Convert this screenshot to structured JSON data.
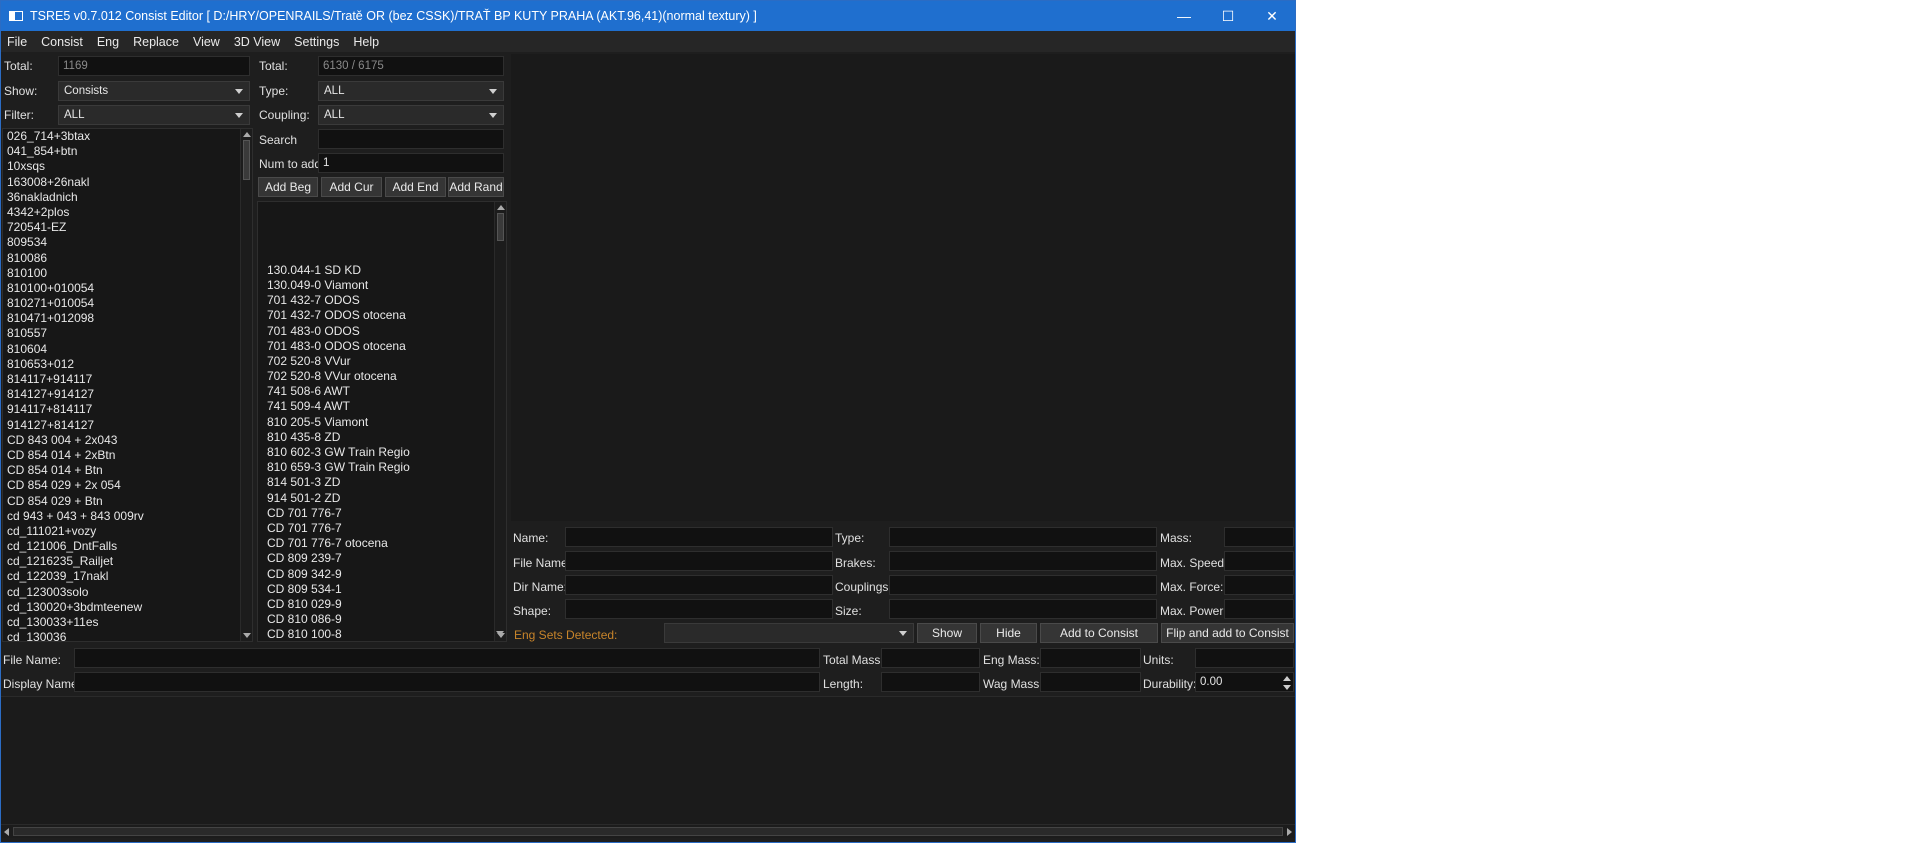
{
  "window": {
    "title": "TSRE5 v0.7.012 Consist Editor   [ D:/HRY/OPENRAILS/Tratě OR (bez CSSK)/TRAŤ BP KUTY PRAHA (AKT.96,41)(normal textury) ]",
    "minimize": "—",
    "maximize": "☐",
    "close": "✕"
  },
  "menu": [
    "File",
    "Consist",
    "Eng",
    "Replace",
    "View",
    "3D View",
    "Settings",
    "Help"
  ],
  "left_panel": {
    "total_label": "Total:",
    "total_value": "1169",
    "show_label": "Show:",
    "show_value": "Consists",
    "filter_label": "Filter:",
    "filter_value": "ALL",
    "items": [
      "026_714+3btax",
      "041_854+btn",
      "10xsqs",
      "163008+26nakl",
      "36nakladnich",
      "4342+2plos",
      "720541-EZ",
      "809534",
      "810086",
      "810100",
      "810100+010054",
      "810271+010054",
      "810471+012098",
      "810557",
      "810604",
      "810653+012",
      "814117+914117",
      "814127+914127",
      "914117+814117",
      "914127+814127",
      "CD 843 004 + 2x043",
      "CD 854 014 + 2xBtn",
      "CD 854 014 + Btn",
      "CD 854 029 + 2x 054",
      "CD 854 029 + Btn",
      "cd 943 + 043 + 843 009rv",
      "cd_111021+vozy",
      "cd_121006_DntFalls",
      "cd_1216235_Railjet",
      "cd_122039_17nakl",
      "cd_123003solo",
      "cd_130020+3bdmteenew",
      "cd_130033+11es",
      "cd_130036"
    ]
  },
  "middle_panel": {
    "total_label": "Total:",
    "total_value": "6130 / 6175",
    "type_label": "Type:",
    "type_value": "ALL",
    "coupling_label": "Coupling:",
    "coupling_value": "ALL",
    "search_label": "Search",
    "search_value": "",
    "num_label": "Num to add",
    "num_value": "1",
    "buttons": [
      "Add Beg",
      "Add Cur",
      "Add End",
      "Add Rand"
    ],
    "items": [
      "",
      "",
      "",
      "",
      "130.044-1 SD KD",
      "130.049-0 Viamont",
      "701 432-7 ODOS",
      "701 432-7 ODOS otocena",
      "701 483-0 ODOS",
      "701 483-0 ODOS otocena",
      "702 520-8 VVur",
      "702 520-8 VVur otocena",
      "741 508-6 AWT",
      "741 509-4 AWT",
      "810 205-5 Viamont",
      "810 435-8 ZD",
      "810 602-3 GW Train Regio",
      "810 659-3 GW Train Regio",
      "814 501-3 ZD",
      "914 501-2 ZD",
      "CD 701 776-7",
      "CD 701 776-7",
      "CD 701 776-7 otocena",
      "CD 809 239-7",
      "CD 809 342-9",
      "CD 809 534-1",
      "CD 810 029-9",
      "CD 810 086-9",
      "CD 810 100-8"
    ]
  },
  "details": {
    "name_label": "Name:",
    "filename_label": "File Name:",
    "dirname_label": "Dir Name:",
    "shape_label": "Shape:",
    "type_label": "Type:",
    "brakes_label": "Brakes:",
    "couplings_label": "Couplings:",
    "size_label": "Size:",
    "mass_label": "Mass:",
    "maxspeed_label": "Max. Speed:",
    "maxforce_label": "Max. Force:",
    "maxpower_label": "Max. Power:",
    "engsets_label": "Eng Sets Detected:",
    "show_btn": "Show",
    "hide_btn": "Hide",
    "add_btn": "Add to Consist",
    "flip_btn": "Flip and add to Consist"
  },
  "consist": {
    "filename_label": "File Name:",
    "displayname_label": "Display Name:",
    "totalmass_label": "Total Mass:",
    "length_label": "Length:",
    "engmass_label": "Eng Mass:",
    "wagmass_label": "Wag Mass:",
    "units_label": "Units:",
    "durability_label": "Durability:",
    "durability_value": "0.00"
  },
  "colors": {
    "titlebar": "#1f6fcf",
    "background": "#1e1e1e",
    "accent_orange": "#c8842a"
  }
}
